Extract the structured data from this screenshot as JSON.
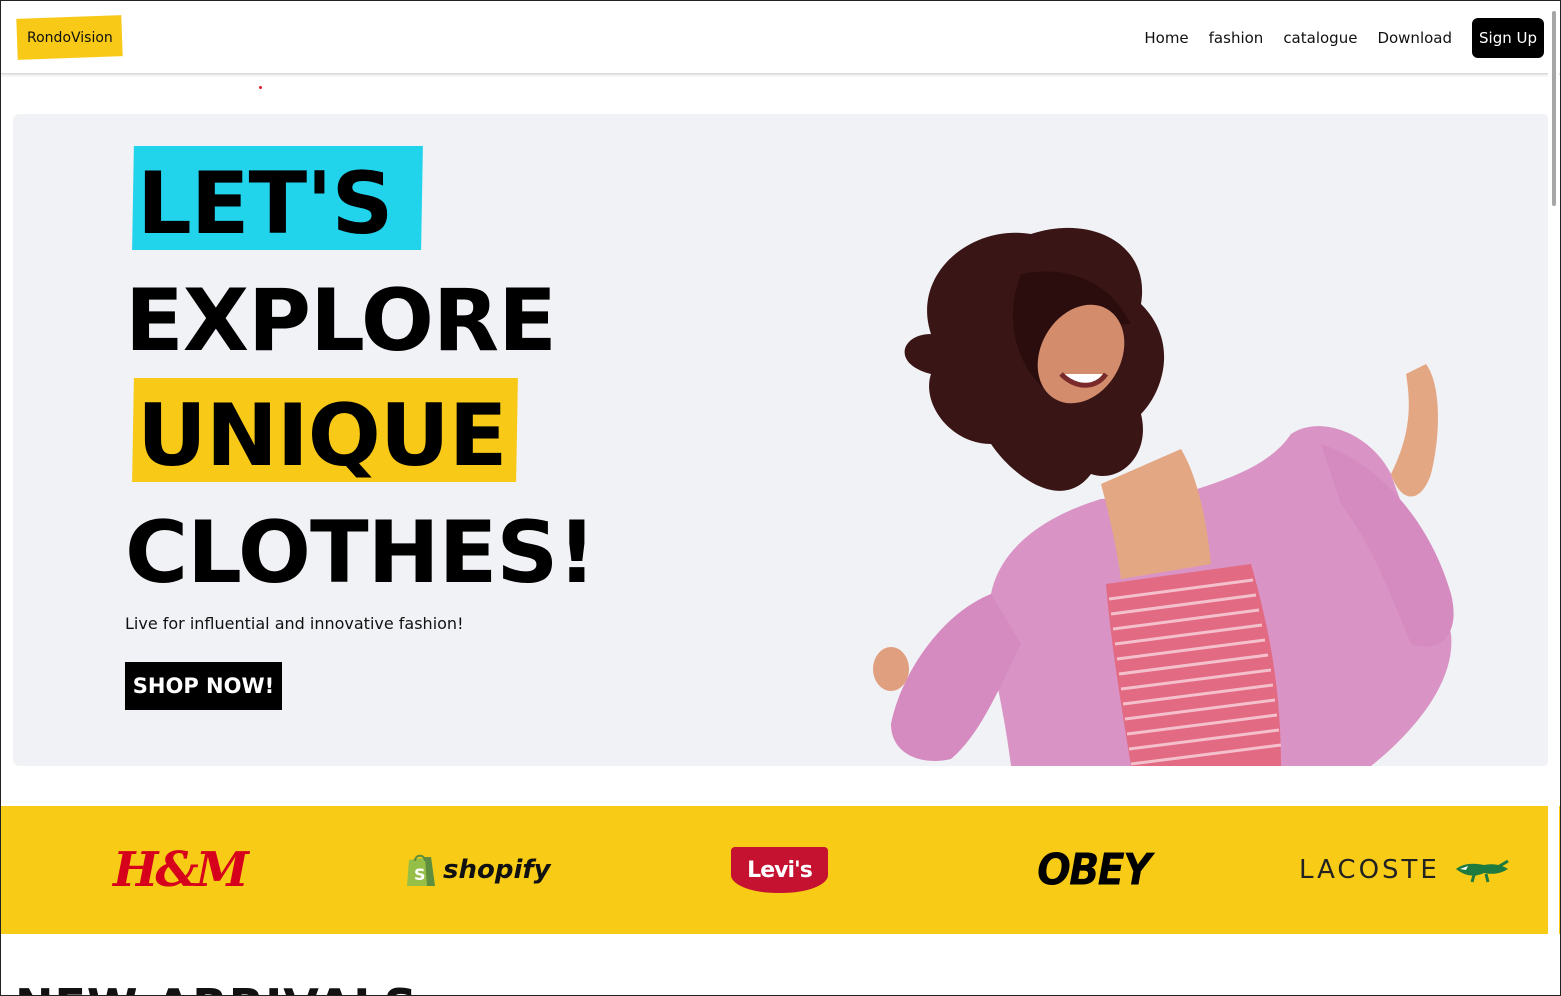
{
  "navbar": {
    "logo_text": "RondoVision",
    "links": [
      "Home",
      "fashion",
      "catalogue",
      "Download"
    ],
    "signup_label": "Sign Up"
  },
  "hero": {
    "headline_lines": [
      "LET'S",
      "EXPLORE",
      "UNIQUE",
      "CLOTHES!"
    ],
    "tagline": "Live for influential and innovative fashion!",
    "cta_label": "SHOP NOW!",
    "highlight_colors": {
      "cyan": "#22d3ec",
      "yellow": "#f8c916"
    },
    "background": "#f0f2f6"
  },
  "brands": {
    "background": "#f8cc16",
    "items": [
      "H&M",
      "shopify",
      "Levi's",
      "OBEY",
      "LACOSTE"
    ]
  },
  "section": {
    "partial_heading": "NEW ARRIVALS"
  }
}
